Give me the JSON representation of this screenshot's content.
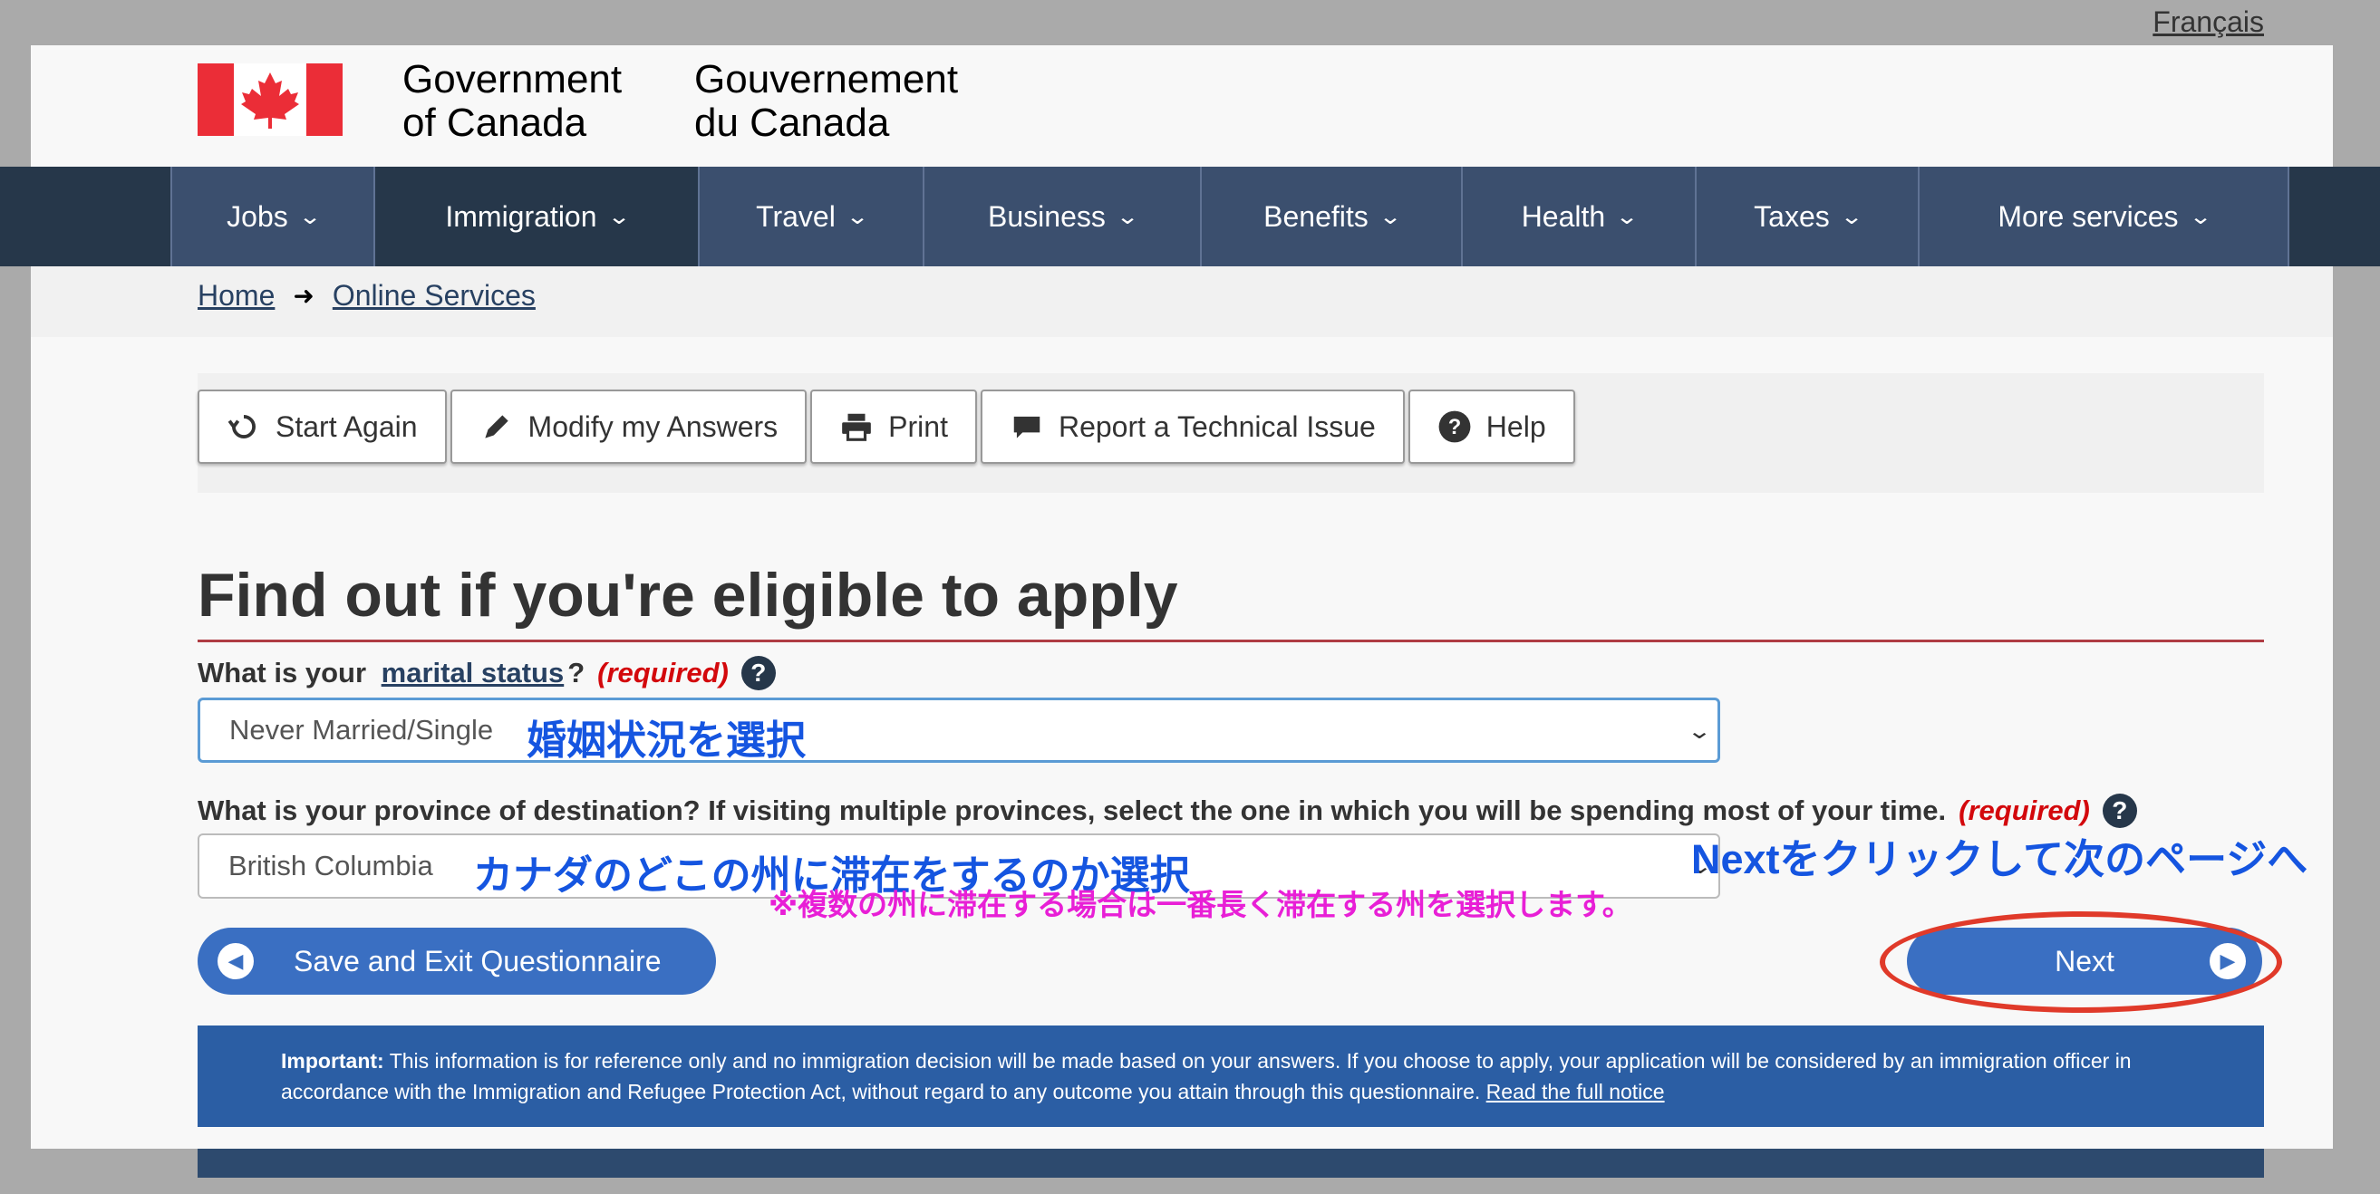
{
  "language_toggle": "Français",
  "header": {
    "wordmark_en": [
      "Government",
      "of Canada"
    ],
    "wordmark_fr": [
      "Gouvernement",
      "du Canada"
    ],
    "flag_colors": {
      "red": "#eb2d37",
      "white": "#ffffff"
    }
  },
  "nav": {
    "items": [
      {
        "label": "Jobs",
        "icon": "chevron-down-icon"
      },
      {
        "label": "Immigration",
        "icon": "chevron-down-icon",
        "active": true
      },
      {
        "label": "Travel",
        "icon": "chevron-down-icon"
      },
      {
        "label": "Business",
        "icon": "chevron-down-icon"
      },
      {
        "label": "Benefits",
        "icon": "chevron-down-icon"
      },
      {
        "label": "Health",
        "icon": "chevron-down-icon"
      },
      {
        "label": "Taxes",
        "icon": "chevron-down-icon"
      },
      {
        "label": "More services",
        "icon": "chevron-down-icon"
      }
    ]
  },
  "breadcrumb": {
    "home": "Home",
    "online_services": "Online Services"
  },
  "toolbar": {
    "start_again": "Start Again",
    "modify": "Modify my Answers",
    "print": "Print",
    "report": "Report a Technical Issue",
    "help": "Help"
  },
  "main": {
    "title": "Find out if you're eligible to apply",
    "q1": {
      "prefix": "What is your",
      "link": "marital status",
      "suffix": "?",
      "required": "(required)",
      "value": "Never Married/Single",
      "annotation": "婚姻状況を選択"
    },
    "q2": {
      "label": "What is your province of destination? If visiting multiple provinces, select the one in which you will be spending most of your time.",
      "required": "(required)",
      "value": "British Columbia",
      "annotation": "カナダのどこの州に滞在をするのか選択"
    },
    "note_pink": "※複数の州に滞在する場合は一番長く滞在する州を選択します。",
    "note_next": "Nextをクリックして次のページへ",
    "save_exit": "Save and Exit Questionnaire",
    "next": "Next"
  },
  "notice": {
    "bold": "Important:",
    "text": " This information is for reference only and no immigration decision will be made based on your answers. If you choose to apply, your application will be considered by an immigration officer in accordance with the Immigration and Refugee Protection Act, without regard to any outcome you attain through this questionnaire.",
    "link": "Read the full notice"
  },
  "colors": {
    "nav_bg": "#3b4f6e",
    "nav_active": "#26374a",
    "button_blue": "#3a6fc2",
    "annotation_blue": "#1555e0",
    "annotation_pink": "#e81fd6",
    "highlight_red": "#e03a2a",
    "required_red": "#d3080c"
  }
}
